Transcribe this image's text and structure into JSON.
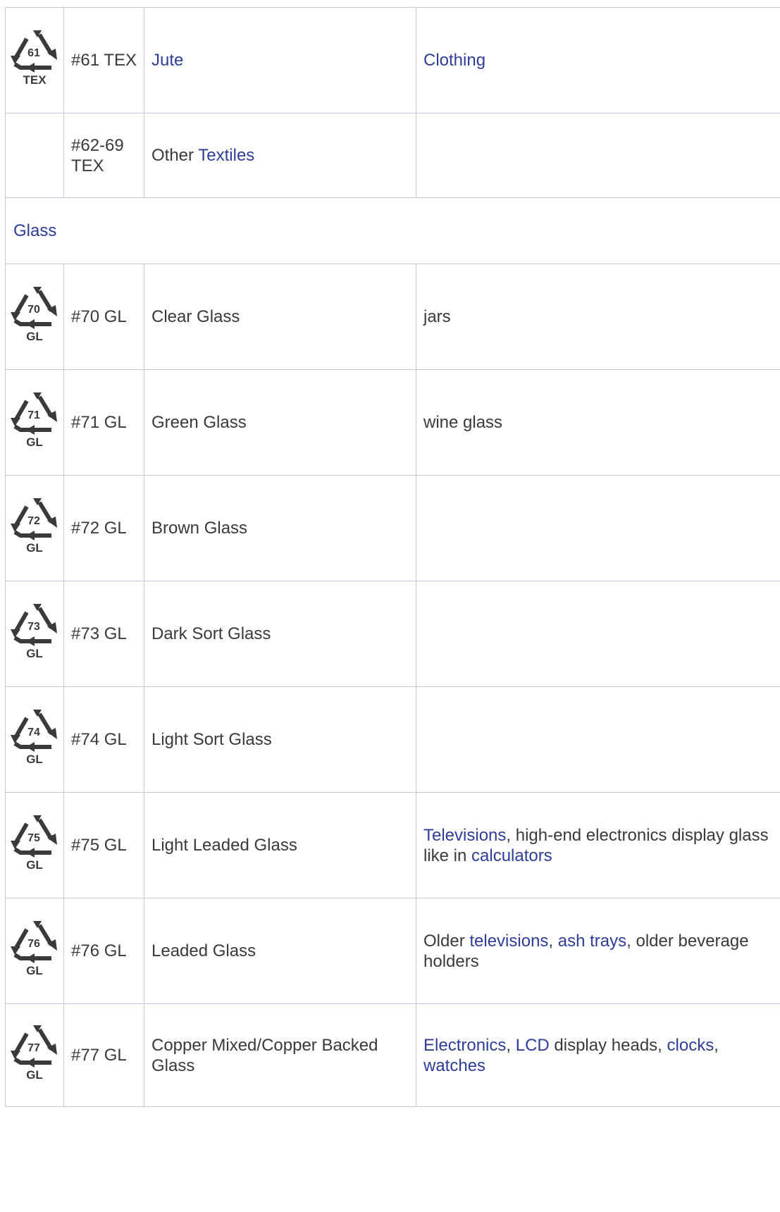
{
  "colors": {
    "link": "#2f3d9a",
    "text": "#3a3a3a",
    "border": "#c3c7df"
  },
  "rows": {
    "r61": {
      "icon": {
        "name": "recycle-icon",
        "number": "61",
        "abbr": "TEX"
      },
      "code": "#61 TEX",
      "material": "Jute",
      "uses": "Clothing"
    },
    "r6269": {
      "code_line1": "#62-69",
      "code_line2": "TEX",
      "material_prefix": "Other",
      "material_link": "Textiles"
    },
    "glass_header": {
      "label": "Glass"
    },
    "r70": {
      "icon": {
        "name": "recycle-icon",
        "number": "70",
        "abbr": "GL"
      },
      "code": "#70 GL",
      "material": "Clear Glass",
      "uses": "jars"
    },
    "r71": {
      "icon": {
        "name": "recycle-icon",
        "number": "71",
        "abbr": "GL"
      },
      "code": "#71 GL",
      "material": "Green Glass",
      "uses": "wine glass"
    },
    "r72": {
      "icon": {
        "name": "recycle-icon",
        "number": "72",
        "abbr": "GL"
      },
      "code": "#72 GL",
      "material": "Brown Glass"
    },
    "r73": {
      "icon": {
        "name": "recycle-icon",
        "number": "73",
        "abbr": "GL"
      },
      "code": "#73 GL",
      "material": "Dark Sort Glass"
    },
    "r74": {
      "icon": {
        "name": "recycle-icon",
        "number": "74",
        "abbr": "GL"
      },
      "code": "#74 GL",
      "material": "Light Sort Glass"
    },
    "r75": {
      "icon": {
        "name": "recycle-icon",
        "number": "75",
        "abbr": "GL"
      },
      "code": "#75 GL",
      "material": "Light Leaded Glass",
      "uses": {
        "link1": "Televisions",
        "text1": ", high-end electronics display glass like in ",
        "link2": "calculators"
      }
    },
    "r76": {
      "icon": {
        "name": "recycle-icon",
        "number": "76",
        "abbr": "GL"
      },
      "code": "#76 GL",
      "material": "Leaded Glass",
      "uses": {
        "text1": "Older ",
        "link1": "televisions",
        "text2": ", ",
        "link2": "ash trays",
        "text3": ", older beverage holders"
      }
    },
    "r77": {
      "icon": {
        "name": "recycle-icon",
        "number": "77",
        "abbr": "GL"
      },
      "code": "#77 GL",
      "material": "Copper Mixed/Copper Backed Glass",
      "uses": {
        "link1": "Electronics",
        "text1": ", ",
        "link2": "LCD",
        "text2": " display heads, ",
        "link3": "clocks",
        "text3": ", ",
        "link4": "watches"
      }
    }
  }
}
